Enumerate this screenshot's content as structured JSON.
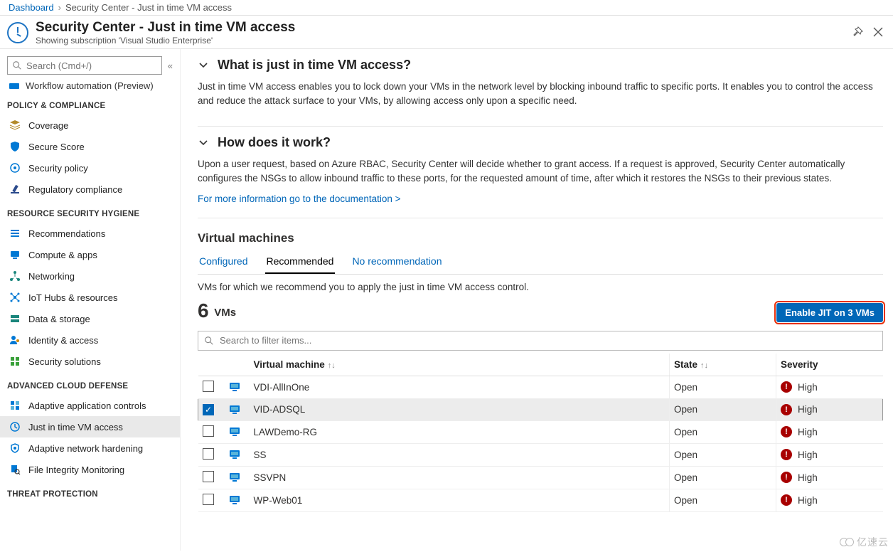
{
  "breadcrumb": {
    "root": "Dashboard",
    "current": "Security Center - Just in time VM access"
  },
  "header": {
    "title": "Security Center - Just in time VM access",
    "subtitle": "Showing subscription 'Visual Studio Enterprise'"
  },
  "sidebar": {
    "search_placeholder": "Search (Cmd+/)",
    "cut_item": "Workflow automation (Preview)",
    "groups": [
      {
        "label": "POLICY & COMPLIANCE",
        "items": [
          {
            "name": "coverage",
            "label": "Coverage",
            "icon": "layers-icon"
          },
          {
            "name": "secure-score",
            "label": "Secure Score",
            "icon": "shield-icon"
          },
          {
            "name": "security-policy",
            "label": "Security policy",
            "icon": "policy-icon"
          },
          {
            "name": "regulatory-compliance",
            "label": "Regulatory compliance",
            "icon": "gavel-icon"
          }
        ]
      },
      {
        "label": "RESOURCE SECURITY HYGIENE",
        "items": [
          {
            "name": "recommendations",
            "label": "Recommendations",
            "icon": "list-icon"
          },
          {
            "name": "compute-apps",
            "label": "Compute & apps",
            "icon": "compute-icon"
          },
          {
            "name": "networking",
            "label": "Networking",
            "icon": "network-icon"
          },
          {
            "name": "iot-hubs",
            "label": "IoT Hubs & resources",
            "icon": "iot-icon"
          },
          {
            "name": "data-storage",
            "label": "Data & storage",
            "icon": "storage-icon"
          },
          {
            "name": "identity-access",
            "label": "Identity & access",
            "icon": "identity-icon"
          },
          {
            "name": "security-solutions",
            "label": "Security solutions",
            "icon": "grid-icon"
          }
        ]
      },
      {
        "label": "ADVANCED CLOUD DEFENSE",
        "items": [
          {
            "name": "adaptive-app-controls",
            "label": "Adaptive application controls",
            "icon": "app-control-icon"
          },
          {
            "name": "jit-vm-access",
            "label": "Just in time VM access",
            "icon": "clock-icon",
            "active": true
          },
          {
            "name": "adaptive-network",
            "label": "Adaptive network hardening",
            "icon": "network-hard-icon"
          },
          {
            "name": "file-integrity",
            "label": "File Integrity Monitoring",
            "icon": "file-search-icon"
          }
        ]
      },
      {
        "label": "THREAT PROTECTION",
        "items": []
      }
    ]
  },
  "content": {
    "section1": {
      "title": "What is just in time VM access?",
      "body": "Just in time VM access enables you to lock down your VMs in the network level by blocking inbound traffic to specific ports. It enables you to control the access and reduce the attack surface to your VMs, by allowing access only upon a specific need."
    },
    "section2": {
      "title": "How does it work?",
      "body": "Upon a user request, based on Azure RBAC, Security Center will decide whether to grant access. If a request is approved, Security Center automatically configures the NSGs to allow inbound traffic to these ports, for the requested amount of time, after which it restores the NSGs to their previous states.",
      "doclink": "For more information go to the documentation >"
    },
    "vm": {
      "heading": "Virtual machines",
      "tabs": {
        "configured": "Configured",
        "recommended": "Recommended",
        "none": "No recommendation"
      },
      "desc": "VMs for which we recommend you to apply the just in time VM access control.",
      "count": "6",
      "count_label": "VMs",
      "enable_button": "Enable JIT on 3 VMs",
      "filter_placeholder": "Search to filter items...",
      "columns": {
        "vm": "Virtual machine",
        "state": "State",
        "severity": "Severity"
      },
      "rows": [
        {
          "name": "VDI-AllInOne",
          "state": "Open",
          "severity": "High",
          "checked": false
        },
        {
          "name": "VID-ADSQL",
          "state": "Open",
          "severity": "High",
          "checked": true
        },
        {
          "name": "LAWDemo-RG",
          "state": "Open",
          "severity": "High",
          "checked": false
        },
        {
          "name": "SS",
          "state": "Open",
          "severity": "High",
          "checked": false
        },
        {
          "name": "SSVPN",
          "state": "Open",
          "severity": "High",
          "checked": false
        },
        {
          "name": "WP-Web01",
          "state": "Open",
          "severity": "High",
          "checked": false
        }
      ]
    }
  },
  "watermark": "亿速云"
}
